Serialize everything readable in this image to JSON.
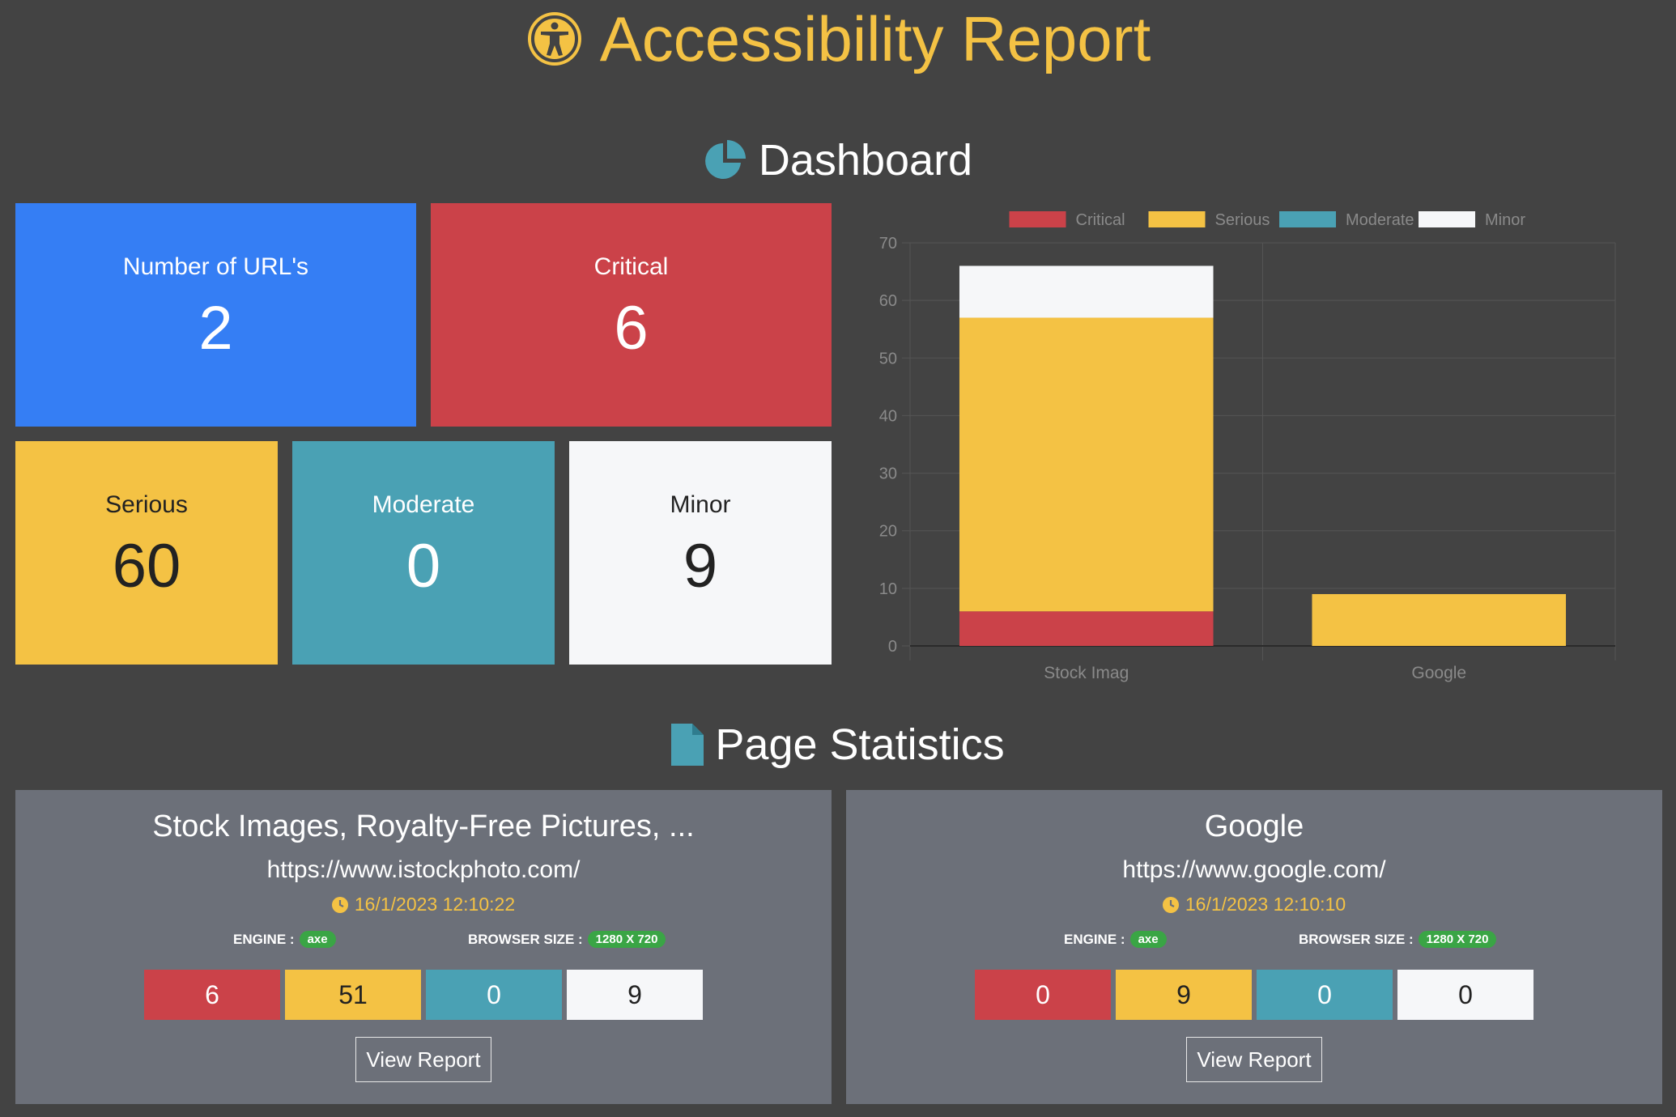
{
  "header": {
    "title": "Accessibility Report",
    "icon": "accessibility-icon"
  },
  "dashboard": {
    "heading": "Dashboard",
    "heading_icon": "pie-chart-icon",
    "cards": {
      "urls": {
        "label": "Number of URL's",
        "value": "2",
        "color": "#357ef4"
      },
      "critical": {
        "label": "Critical",
        "value": "6",
        "color": "#cb4249"
      },
      "serious": {
        "label": "Serious",
        "value": "60",
        "color": "#f4c244"
      },
      "moderate": {
        "label": "Moderate",
        "value": "0",
        "color": "#4aa1b4"
      },
      "minor": {
        "label": "Minor",
        "value": "9",
        "color": "#f6f7f9"
      }
    }
  },
  "chart_data": {
    "type": "bar",
    "stacked": true,
    "categories": [
      "Stock Imag",
      "Google"
    ],
    "series": [
      {
        "name": "Critical",
        "values": [
          6,
          0
        ],
        "color": "#cb4249"
      },
      {
        "name": "Serious",
        "values": [
          51,
          9
        ],
        "color": "#f4c244"
      },
      {
        "name": "Moderate",
        "values": [
          0,
          0
        ],
        "color": "#4aa1b4"
      },
      {
        "name": "Minor",
        "values": [
          9,
          0
        ],
        "color": "#f6f7f9"
      }
    ],
    "ylim": [
      0,
      70
    ],
    "yticks": [
      0,
      10,
      20,
      30,
      40,
      50,
      60,
      70
    ],
    "grid": true,
    "legend": "top"
  },
  "page_statistics": {
    "heading": "Page Statistics",
    "heading_icon": "file-icon",
    "pages": [
      {
        "title": "Stock Images, Royalty-Free Pictures, ...",
        "url": "https://www.istockphoto.com/",
        "timestamp": "16/1/2023 12:10:22",
        "engine_label": "ENGINE :",
        "engine": "axe",
        "browser_label": "BROWSER SIZE :",
        "browser_size": "1280 X 720",
        "counts": {
          "critical": "6",
          "serious": "51",
          "moderate": "0",
          "minor": "9"
        },
        "button": "View Report"
      },
      {
        "title": "Google",
        "url": "https://www.google.com/",
        "timestamp": "16/1/2023 12:10:10",
        "engine_label": "ENGINE :",
        "engine": "axe",
        "browser_label": "BROWSER SIZE :",
        "browser_size": "1280 X 720",
        "counts": {
          "critical": "0",
          "serious": "9",
          "moderate": "0",
          "minor": "0"
        },
        "button": "View Report"
      }
    ]
  }
}
